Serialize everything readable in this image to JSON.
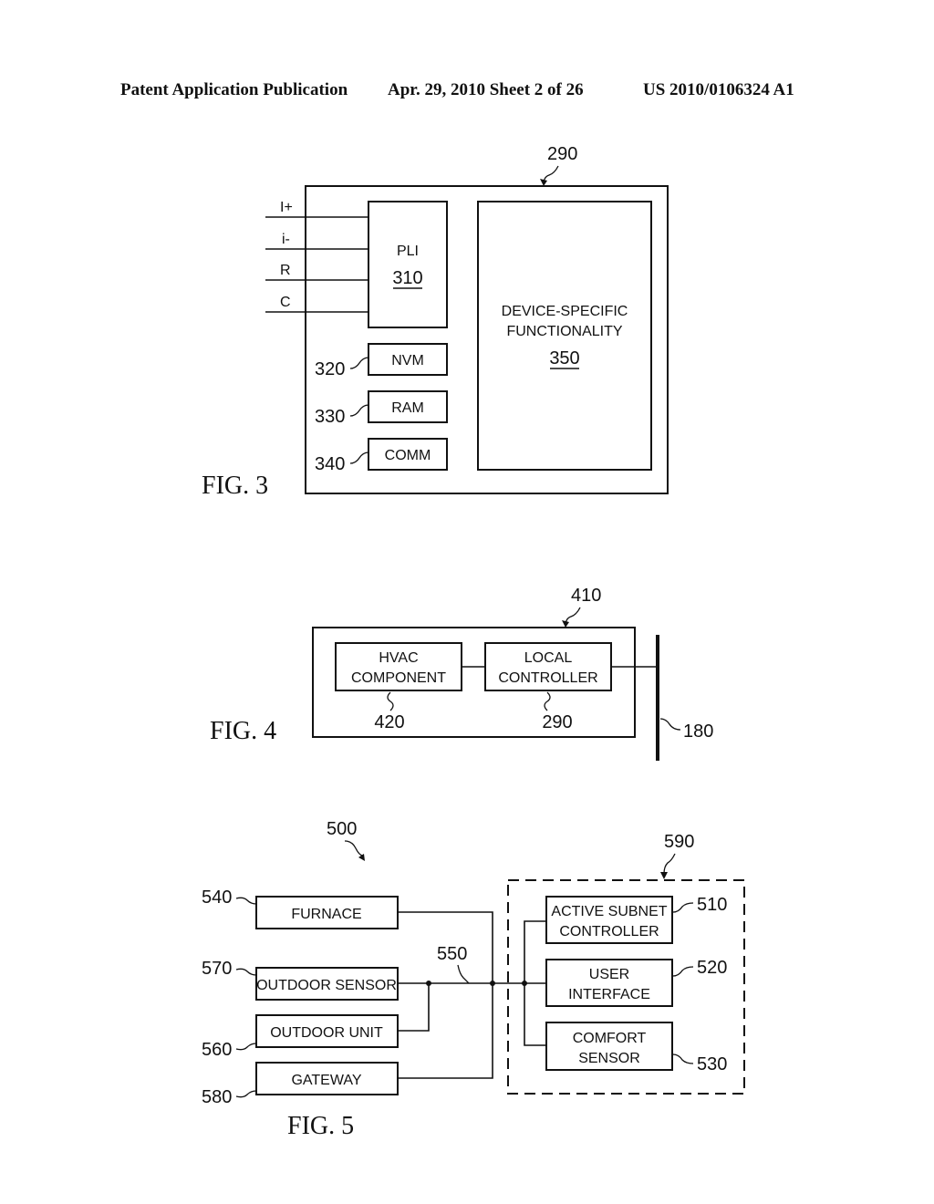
{
  "header": {
    "publication": "Patent Application Publication",
    "date_sheet": "Apr. 29, 2010  Sheet 2 of 26",
    "patent_number": "US 2010/0106324 A1"
  },
  "fig3": {
    "caption": "FIG. 3",
    "ref_outer": "290",
    "inputs": [
      "I+",
      "i-",
      "R",
      "C"
    ],
    "pli": {
      "label": "PLI",
      "ref": "310"
    },
    "nvm": {
      "label": "NVM",
      "ref": "320"
    },
    "ram": {
      "label": "RAM",
      "ref": "330"
    },
    "comm": {
      "label": "COMM",
      "ref": "340"
    },
    "dsf": {
      "line1": "DEVICE-SPECIFIC",
      "line2": "FUNCTIONALITY",
      "ref": "350"
    }
  },
  "fig4": {
    "caption": "FIG. 4",
    "ref_outer": "410",
    "hvac": {
      "line1": "HVAC",
      "line2": "COMPONENT",
      "ref": "420"
    },
    "local": {
      "line1": "LOCAL",
      "line2": "CONTROLLER",
      "ref": "290"
    },
    "bus_ref": "180"
  },
  "fig5": {
    "caption": "FIG. 5",
    "ref_system": "500",
    "ref_subnet": "590",
    "bus_ref": "550",
    "furnace": {
      "label": "FURNACE",
      "ref": "540"
    },
    "outdoor_sensor": {
      "label": "OUTDOOR SENSOR",
      "ref": "570"
    },
    "outdoor_unit": {
      "label": "OUTDOOR UNIT",
      "ref": "560"
    },
    "gateway": {
      "label": "GATEWAY",
      "ref": "580"
    },
    "asc": {
      "line1": "ACTIVE SUBNET",
      "line2": "CONTROLLER",
      "ref": "510"
    },
    "ui": {
      "line1": "USER",
      "line2": "INTERFACE",
      "ref": "520"
    },
    "comfort": {
      "line1": "COMFORT",
      "line2": "SENSOR",
      "ref": "530"
    }
  }
}
